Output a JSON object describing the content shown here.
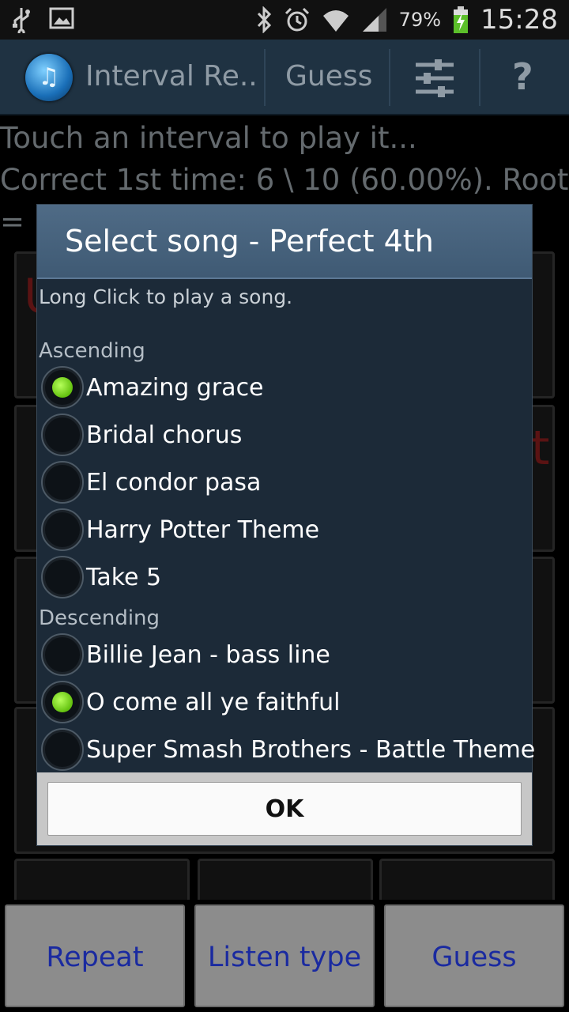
{
  "status_bar": {
    "battery_percent": "79%",
    "time": "15:28",
    "icons": [
      "usb-icon",
      "image-icon",
      "bluetooth-icon",
      "alarm-icon",
      "wifi-icon",
      "signal-icon",
      "battery-charging-icon"
    ]
  },
  "action_bar": {
    "app_title": "Interval Re..",
    "guess_label": "Guess",
    "tune_icon": "sliders-icon",
    "help_label": "?"
  },
  "info": {
    "line1": "Touch an interval to play it...",
    "line2": "Correct 1st time: 6 \\ 10 (60.00%).  Root",
    "line3": "= F"
  },
  "dialog": {
    "title": "Select song - Perfect 4th",
    "hint": "Long Click to play a song.",
    "ascending_label": "Ascending",
    "ascending": [
      {
        "label": "Amazing grace",
        "checked": true
      },
      {
        "label": "Bridal chorus",
        "checked": false
      },
      {
        "label": "El condor pasa",
        "checked": false
      },
      {
        "label": "Harry Potter Theme",
        "checked": false
      },
      {
        "label": "Take 5",
        "checked": false
      }
    ],
    "descending_label": "Descending",
    "descending": [
      {
        "label": "Billie Jean - bass line",
        "checked": false
      },
      {
        "label": "O come all ye faithful",
        "checked": true
      },
      {
        "label": "Super Smash Brothers - Battle Theme",
        "checked": false
      }
    ],
    "ok_label": "OK"
  },
  "bottom_buttons": {
    "repeat": "Repeat",
    "listen_type": "Listen type",
    "guess": "Guess"
  },
  "colors": {
    "action_bar": "#1f3242",
    "dialog_bg": "#1c2a38",
    "dialog_title": "#4f6b86",
    "radio_checked": "#7ed321",
    "button_text": "#1a2aa0"
  }
}
